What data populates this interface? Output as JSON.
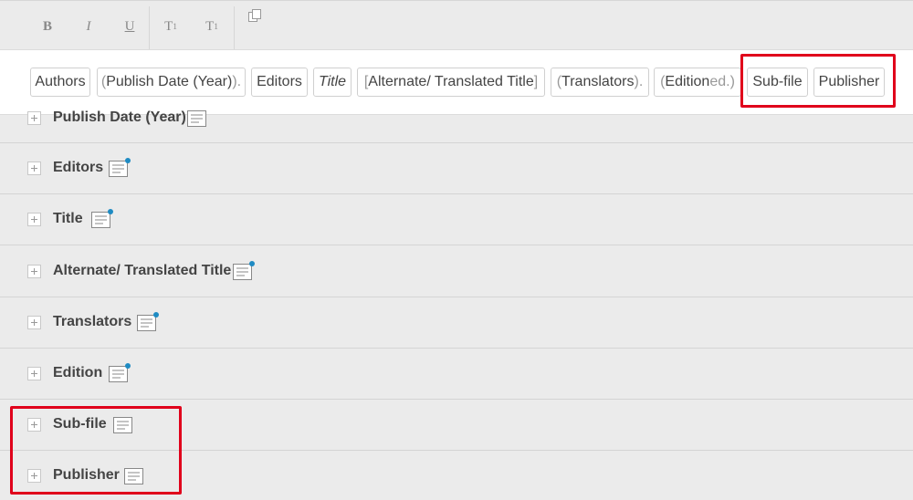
{
  "toolbar": {
    "bold": "B",
    "italic": "I",
    "underline": "U",
    "superscript_base": "T",
    "superscript_mark": "1",
    "subscript_base": "T",
    "subscript_mark": "1"
  },
  "preview": {
    "chips": [
      {
        "pre": "",
        "text": "Authors",
        "post": "",
        "italic": false
      },
      {
        "pre": "(",
        "text": "Publish Date (Year)",
        "post": ").",
        "italic": false
      },
      {
        "pre": "",
        "text": "Editors",
        "post": "",
        "italic": false
      },
      {
        "pre": "",
        "text": "Title",
        "post": "",
        "italic": true
      },
      {
        "pre": "[",
        "text": "Alternate/ Translated Title",
        "post": "]",
        "italic": false
      },
      {
        "pre": "(",
        "text": "Translators",
        "post": ").",
        "italic": false
      },
      {
        "pre": "(",
        "text": "Edition",
        "post": " ed.)",
        "italic": false
      },
      {
        "pre": "",
        "text": "Sub-file",
        "post": "",
        "italic": false
      },
      {
        "pre": "",
        "text": "Publisher",
        "post": "",
        "italic": false
      }
    ]
  },
  "fields": [
    {
      "label": "Publish Date (Year)",
      "has_note": false
    },
    {
      "label": "Editors",
      "has_note": true
    },
    {
      "label": "Title",
      "has_note": true
    },
    {
      "label": "Alternate/ Translated Title",
      "has_note": true
    },
    {
      "label": "Translators",
      "has_note": true
    },
    {
      "label": "Edition",
      "has_note": true
    },
    {
      "label": "Sub-file",
      "has_note": false
    },
    {
      "label": "Publisher",
      "has_note": false
    }
  ],
  "colors": {
    "highlight": "#e0001b",
    "note_dot": "#1e8bc3"
  }
}
